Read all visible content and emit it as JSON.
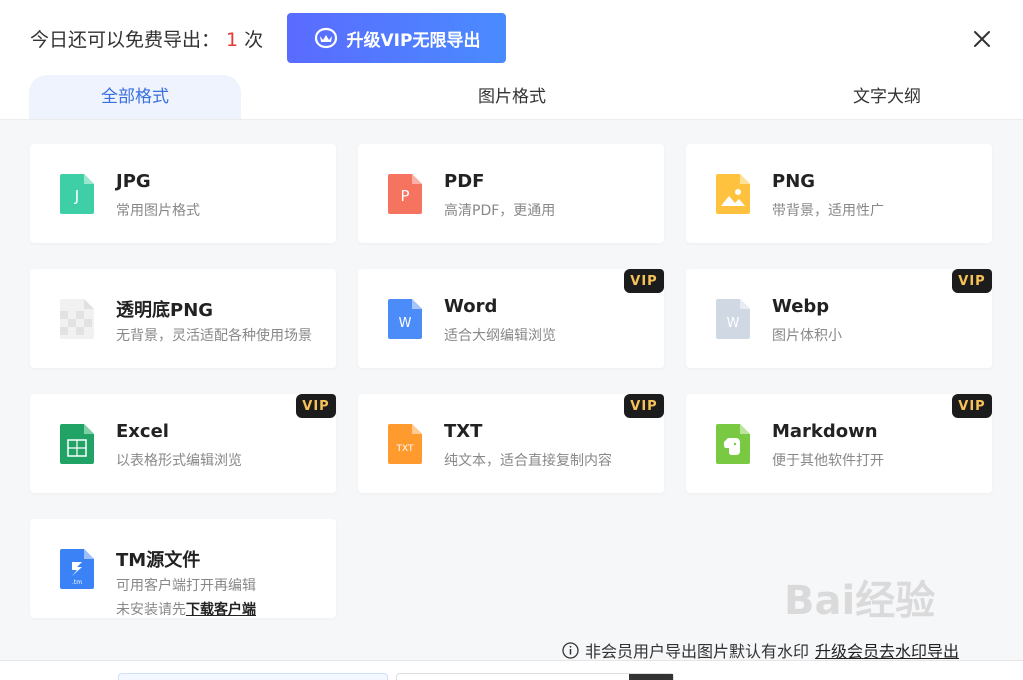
{
  "header": {
    "quota_prefix": "今日还可以免费导出：",
    "quota_count": "1",
    "quota_suffix": "次",
    "vip_button_label": "升级VIP无限导出"
  },
  "tabs": [
    {
      "label": "全部格式",
      "active": true
    },
    {
      "label": "图片格式",
      "active": false
    },
    {
      "label": "文字大纲",
      "active": false
    }
  ],
  "formats": [
    {
      "title": "JPG",
      "desc": "常用图片格式",
      "icon": "jpg-file-icon",
      "icon_color": "#3ecfa6",
      "icon_text": "J",
      "vip": false
    },
    {
      "title": "PDF",
      "desc": "高清PDF，更通用",
      "icon": "pdf-file-icon",
      "icon_color": "#f5735f",
      "icon_text": "P",
      "vip": false
    },
    {
      "title": "PNG",
      "desc": "带背景，适用性广",
      "icon": "png-file-icon",
      "icon_color": "#ffc23f",
      "icon_text": "",
      "vip": false
    },
    {
      "title": "透明底PNG",
      "desc": "无背景，灵活适配各种使用场景",
      "icon": "transparent-png-file-icon",
      "icon_color": "#e6e6e6",
      "icon_text": "",
      "vip": false
    },
    {
      "title": "Word",
      "desc": "适合大纲编辑浏览",
      "icon": "word-file-icon",
      "icon_color": "#4c8cf8",
      "icon_text": "W",
      "vip": true
    },
    {
      "title": "Webp",
      "desc": "图片体积小",
      "icon": "webp-file-icon",
      "icon_color": "#cfd8e3",
      "icon_text": "W",
      "vip": true
    },
    {
      "title": "Excel",
      "desc": "以表格形式编辑浏览",
      "icon": "excel-file-icon",
      "icon_color": "#21a366",
      "icon_text": "X",
      "vip": true
    },
    {
      "title": "TXT",
      "desc": "纯文本，适合直接复制内容",
      "icon": "txt-file-icon",
      "icon_color": "#ff9a2e",
      "icon_text": "TXT",
      "vip": true
    },
    {
      "title": "Markdown",
      "desc": "便于其他软件打开",
      "icon": "markdown-evernote-icon",
      "icon_color": "#7ac943",
      "icon_text": "",
      "vip": true
    },
    {
      "title": "TM源文件",
      "desc": "可用客户端打开再编辑",
      "desc2_prefix": "未安装请先",
      "desc2_link": "下载客户端",
      "icon": "tm-file-icon",
      "icon_color": "#3b82f6",
      "icon_text": ".tm",
      "vip": false
    }
  ],
  "vip_tag_label": "VIP",
  "footnote": {
    "text": "非会员用户导出图片默认有水印",
    "link": "升级会员去水印导出"
  },
  "watermark_text": "Bai经验"
}
